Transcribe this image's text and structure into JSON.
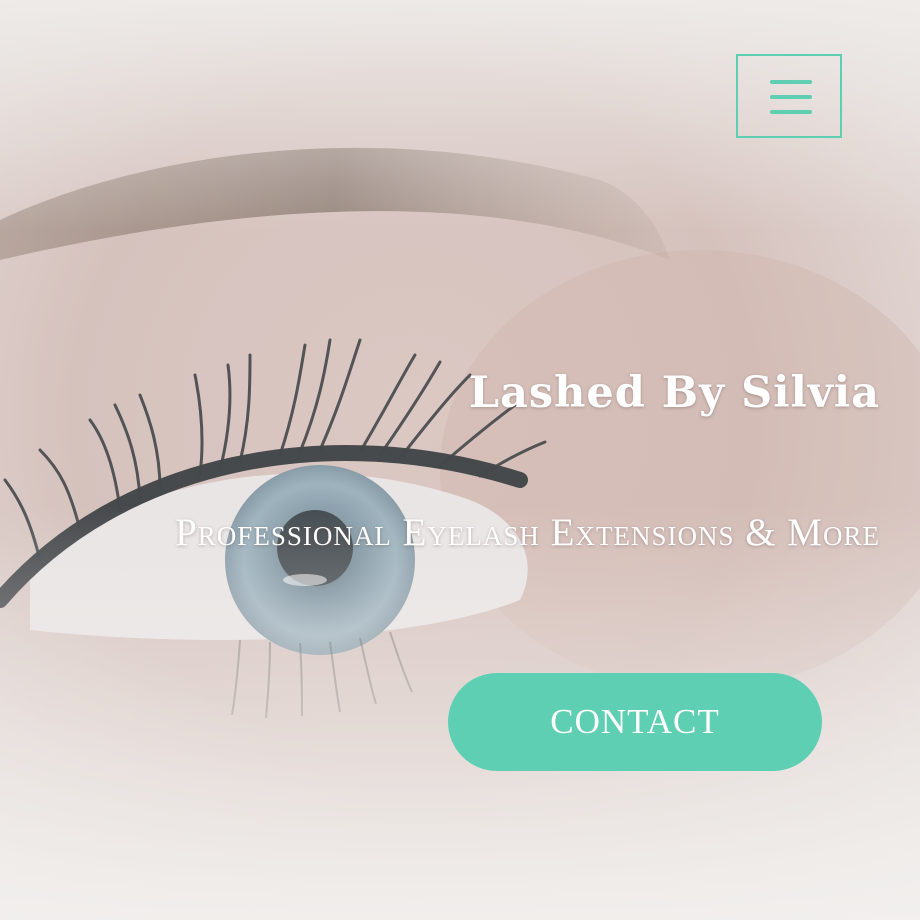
{
  "header": {
    "menu_icon": "hamburger-menu-icon"
  },
  "hero": {
    "title": "Lashed By Silvia",
    "tagline": "Professional Eyelash Extensions & More",
    "contact_label": "CONTACT"
  },
  "colors": {
    "accent": "#5ecfb2",
    "text_light": "#ffffff"
  }
}
